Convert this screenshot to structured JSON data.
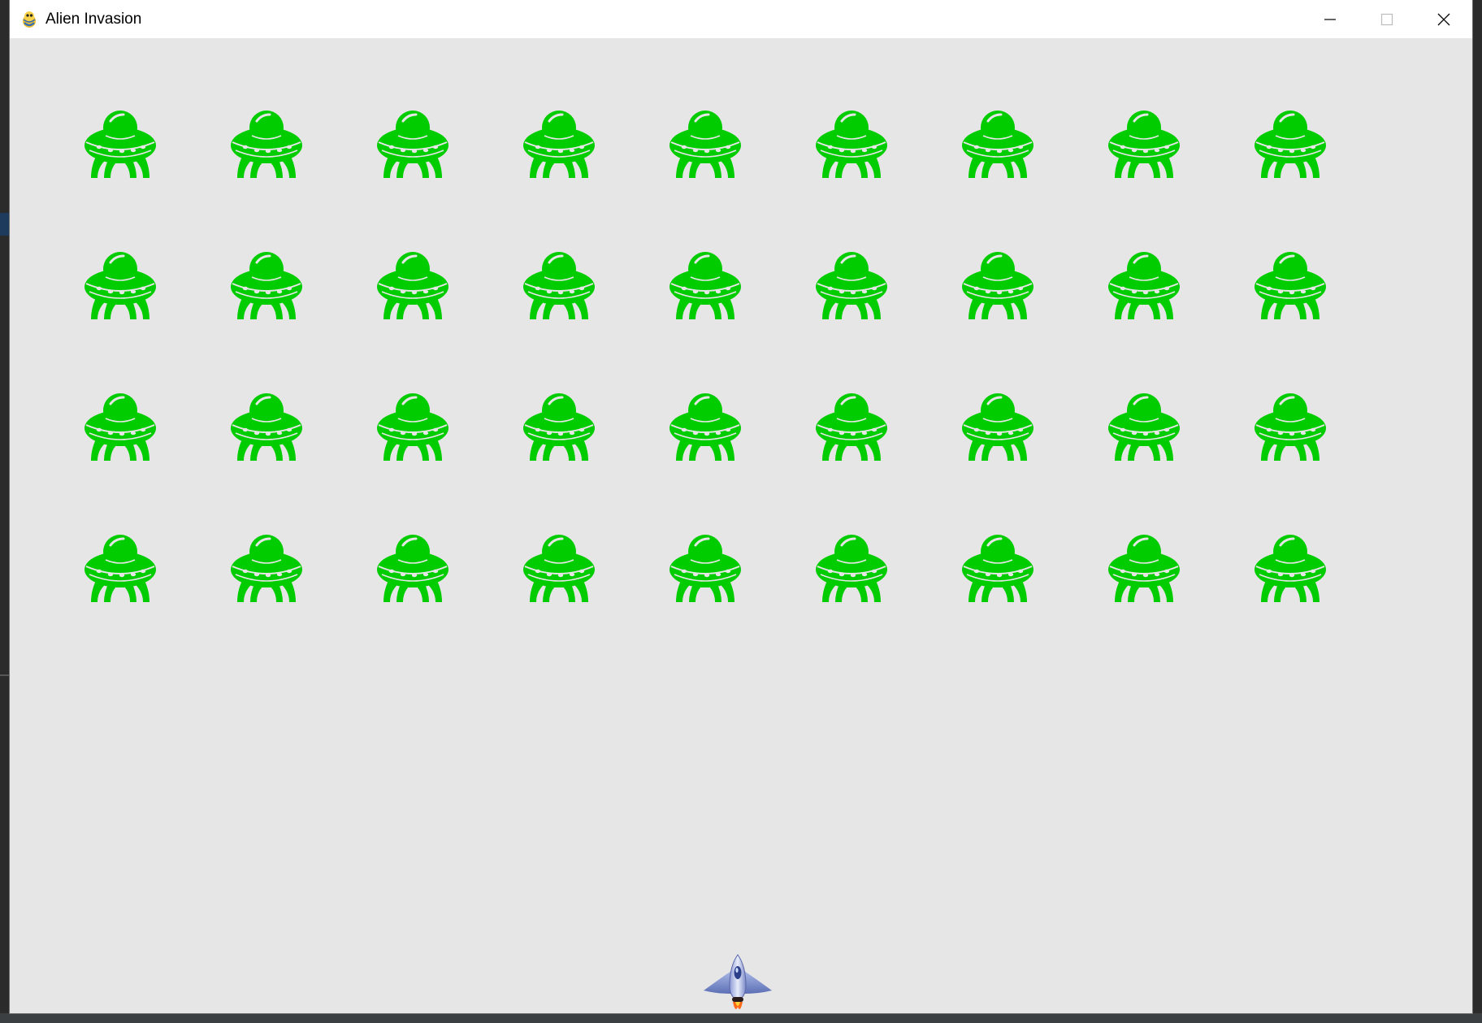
{
  "window": {
    "title": "Alien Invasion",
    "app_icon": "pygame-snake-icon",
    "controls": [
      "minimize-icon",
      "maximize-icon",
      "close-icon"
    ]
  },
  "game": {
    "background_color": "#e6e6e6",
    "alien_color": "#00cc00",
    "fleet": {
      "rows": 4,
      "columns": 9,
      "alien_count": 36
    },
    "ship": {
      "icon": "rocket-ship-icon"
    }
  }
}
